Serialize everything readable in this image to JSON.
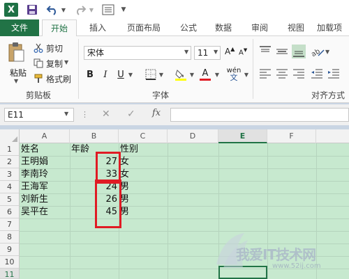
{
  "app": {
    "logo_letter": "X"
  },
  "ribbon_tabs": [
    "文件",
    "开始",
    "插入",
    "页面布局",
    "公式",
    "数据",
    "审阅",
    "视图",
    "加载项"
  ],
  "clipboard": {
    "paste": "粘贴",
    "cut": "剪切",
    "copy": "复制",
    "painter": "格式刷",
    "group": "剪贴板"
  },
  "font": {
    "name": "宋体",
    "size": "11",
    "group": "字体",
    "grow": "A",
    "shrink": "A",
    "bold": "B",
    "italic": "I",
    "underline": "U",
    "color_letter": "A",
    "phonetic": "wén"
  },
  "alignment": {
    "group": "对齐方式"
  },
  "formula_bar": {
    "name_box": "E11",
    "formula": ""
  },
  "columns": [
    "A",
    "B",
    "C",
    "D",
    "E",
    "F"
  ],
  "active_column": "E",
  "rows": [
    "1",
    "2",
    "3",
    "4",
    "5",
    "6",
    "7",
    "8",
    "9",
    "10",
    "11"
  ],
  "active_row": "11",
  "sheet": [
    {
      "A": "姓名",
      "B": "年龄",
      "C": "性别"
    },
    {
      "A": "王明娟",
      "B": "27",
      "C": "女"
    },
    {
      "A": "李南玲",
      "B": "33",
      "C": "女"
    },
    {
      "A": "王海军",
      "B": "24",
      "C": "男"
    },
    {
      "A": "刘新生",
      "B": "26",
      "C": "男"
    },
    {
      "A": "吴平在",
      "B": "45",
      "C": "男"
    }
  ],
  "watermark": {
    "text": "我爱IT技术网",
    "url": "www.52ij.com"
  },
  "colors": {
    "excel_green": "#217346",
    "grid_fill": "#c7e9cf",
    "highlight_red": "#e01b24"
  }
}
